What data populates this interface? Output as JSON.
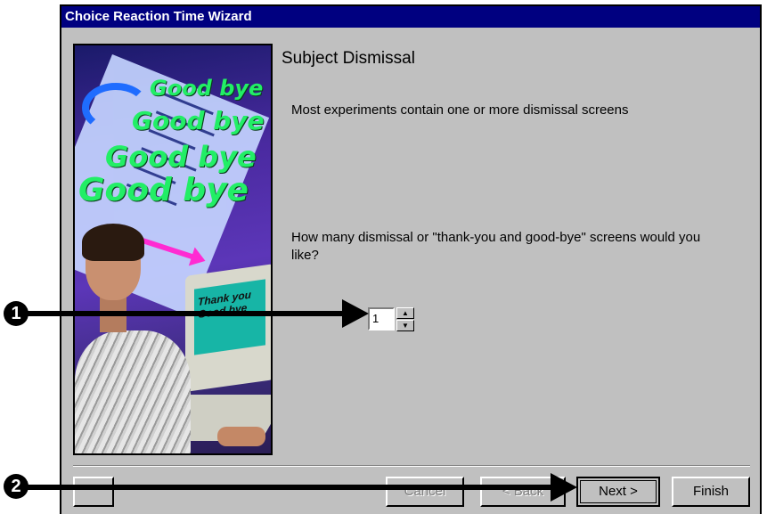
{
  "window": {
    "title": "Choice Reaction Time Wizard"
  },
  "illustration": {
    "screen_text_line1": "Thank you",
    "screen_text_line2": "Good bye",
    "bye_text": "Good bye"
  },
  "page": {
    "heading": "Subject Dismissal",
    "subtitle": "Most experiments contain one or more dismissal screens",
    "question": "How many dismissal or \"thank-you and good-bye\" screens would you like?"
  },
  "spinner": {
    "value": "1"
  },
  "buttons": {
    "help": "",
    "cancel": "Cancel",
    "back": "< Back",
    "next": "Next >",
    "finish": "Finish"
  },
  "callouts": {
    "one": "1",
    "two": "2"
  },
  "colors": {
    "title_bar": "#000080",
    "dialog_bg": "#c0c0c0",
    "callout": "#000000"
  }
}
